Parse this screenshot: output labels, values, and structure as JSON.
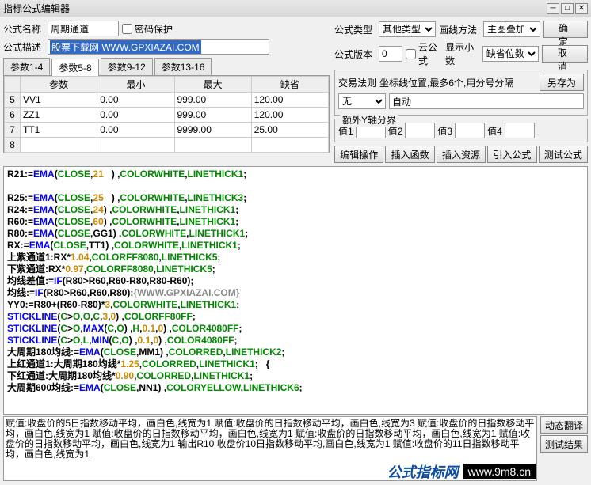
{
  "window": {
    "title": "指标公式编辑器"
  },
  "labels": {
    "formula_name": "公式名称",
    "password": "密码保护",
    "formula_desc": "公式描述",
    "formula_type": "公式类型",
    "draw_method": "画线方法",
    "formula_version": "公式版本",
    "cloud_formula": "云公式",
    "show_decimal": "显示小数",
    "trade_rule": "交易法则",
    "coord_hint": "坐标线位置,最多6个,用分号分隔",
    "extra_y": "额外Y轴分界",
    "val1": "值1",
    "val2": "值2",
    "val3": "值3",
    "val4": "值4",
    "param": "参数",
    "min": "最小",
    "max": "最大",
    "default": "缺省"
  },
  "fields": {
    "formula_name": "周期通道",
    "formula_desc": "股票下载网 WWW.GPXIAZAI.COM",
    "formula_type": "其他类型",
    "draw_method": "主图叠加",
    "formula_version": "0",
    "show_decimal": "缺省位数",
    "trade_rule": "无",
    "coord": "自动"
  },
  "tabs": [
    "参数1-4",
    "参数5-8",
    "参数9-12",
    "参数13-16"
  ],
  "active_tab": 1,
  "param_rows": [
    {
      "n": "5",
      "name": "VV1",
      "min": "0.00",
      "max": "999.00",
      "def": "120.00"
    },
    {
      "n": "6",
      "name": "ZZ1",
      "min": "0.00",
      "max": "999.00",
      "def": "120.00"
    },
    {
      "n": "7",
      "name": "TT1",
      "min": "0.00",
      "max": "9999.00",
      "def": "25.00"
    },
    {
      "n": "8",
      "name": "",
      "min": "",
      "max": "",
      "def": ""
    }
  ],
  "buttons": {
    "ok": "确 定",
    "cancel": "取 消",
    "save_as": "另存为",
    "edit_op": "编辑操作",
    "insert_fn": "插入函数",
    "insert_res": "插入资源",
    "import_formula": "引入公式",
    "test_formula": "测试公式",
    "dyn_trans": "动态翻译",
    "test_result": "测试结果"
  },
  "code_lines": [
    [
      [
        "R21:=",
        "black"
      ],
      [
        "EMA",
        "blue"
      ],
      [
        "(",
        "black"
      ],
      [
        "CLOSE",
        "green"
      ],
      [
        ",",
        "black"
      ],
      [
        "21",
        "orange"
      ],
      [
        "   ) ,",
        "black"
      ],
      [
        "COLORWHITE",
        "green"
      ],
      [
        ",",
        "black"
      ],
      [
        "LINETHICK1",
        "green"
      ],
      [
        ";",
        "black"
      ]
    ],
    [],
    [
      [
        "R25:=",
        "black"
      ],
      [
        "EMA",
        "blue"
      ],
      [
        "(",
        "black"
      ],
      [
        "CLOSE",
        "green"
      ],
      [
        ",",
        "black"
      ],
      [
        "25",
        "orange"
      ],
      [
        "   ) ,",
        "black"
      ],
      [
        "COLORWHITE",
        "green"
      ],
      [
        ",",
        "black"
      ],
      [
        "LINETHICK3",
        "green"
      ],
      [
        ";",
        "black"
      ]
    ],
    [
      [
        "R24:=",
        "black"
      ],
      [
        "EMA",
        "blue"
      ],
      [
        "(",
        "black"
      ],
      [
        "CLOSE",
        "green"
      ],
      [
        ",",
        "black"
      ],
      [
        "24",
        "orange"
      ],
      [
        ") ,",
        "black"
      ],
      [
        "COLORWHITE",
        "green"
      ],
      [
        ",",
        "black"
      ],
      [
        "LINETHICK1",
        "green"
      ],
      [
        ";",
        "black"
      ]
    ],
    [
      [
        "R60:=",
        "black"
      ],
      [
        "EMA",
        "blue"
      ],
      [
        "(",
        "black"
      ],
      [
        "CLOSE",
        "green"
      ],
      [
        ",",
        "black"
      ],
      [
        "60",
        "orange"
      ],
      [
        ") ,",
        "black"
      ],
      [
        "COLORWHITE",
        "green"
      ],
      [
        ",",
        "black"
      ],
      [
        "LINETHICK1",
        "green"
      ],
      [
        ";",
        "black"
      ]
    ],
    [
      [
        "R80:=",
        "black"
      ],
      [
        "EMA",
        "blue"
      ],
      [
        "(",
        "black"
      ],
      [
        "CLOSE",
        "green"
      ],
      [
        ",GG1) ,",
        "black"
      ],
      [
        "COLORWHITE",
        "green"
      ],
      [
        ",",
        "black"
      ],
      [
        "LINETHICK1",
        "green"
      ],
      [
        ";",
        "black"
      ]
    ],
    [
      [
        "RX:=",
        "black"
      ],
      [
        "EMA",
        "blue"
      ],
      [
        "(",
        "black"
      ],
      [
        "CLOSE",
        "green"
      ],
      [
        ",TT1) ,",
        "black"
      ],
      [
        "COLORWHITE",
        "green"
      ],
      [
        ",",
        "black"
      ],
      [
        "LINETHICK1",
        "green"
      ],
      [
        ";",
        "black"
      ]
    ],
    [
      [
        "上紫通道1:RX*",
        "black"
      ],
      [
        "1.04",
        "orange"
      ],
      [
        ",",
        "black"
      ],
      [
        "COLORFF8080",
        "green"
      ],
      [
        ",",
        "black"
      ],
      [
        "LINETHICK5",
        "green"
      ],
      [
        ";",
        "black"
      ]
    ],
    [
      [
        "下紫通道:RX*",
        "black"
      ],
      [
        "0.97",
        "orange"
      ],
      [
        ",",
        "black"
      ],
      [
        "COLORFF8080",
        "green"
      ],
      [
        ",",
        "black"
      ],
      [
        "LINETHICK5",
        "green"
      ],
      [
        ";",
        "black"
      ]
    ],
    [
      [
        "均线差值:=",
        "black"
      ],
      [
        "IF",
        "blue"
      ],
      [
        "(R80>R60,R60-R80,R80-R60);",
        "black"
      ]
    ],
    [
      [
        "均线:=",
        "black"
      ],
      [
        "IF",
        "blue"
      ],
      [
        "(R80>R60,R60,R80);",
        "black"
      ],
      [
        "{WWW.GPXIAZAI.COM}",
        "gray"
      ]
    ],
    [
      [
        "YY0:=R80+(R60-R80)*",
        "black"
      ],
      [
        "3",
        "orange"
      ],
      [
        ",",
        "black"
      ],
      [
        "COLORWHITE",
        "green"
      ],
      [
        ",",
        "black"
      ],
      [
        "LINETHICK1",
        "green"
      ],
      [
        ";",
        "black"
      ]
    ],
    [
      [
        "STICKLINE",
        "blue"
      ],
      [
        "(",
        "black"
      ],
      [
        "C",
        "green"
      ],
      [
        ">",
        "black"
      ],
      [
        "O",
        "green"
      ],
      [
        ",",
        "black"
      ],
      [
        "O",
        "green"
      ],
      [
        ",",
        "black"
      ],
      [
        "C",
        "green"
      ],
      [
        ",",
        "black"
      ],
      [
        "3",
        "orange"
      ],
      [
        ",",
        "black"
      ],
      [
        "0",
        "orange"
      ],
      [
        ") ,",
        "black"
      ],
      [
        "COLORFF80FF",
        "green"
      ],
      [
        ";",
        "black"
      ]
    ],
    [
      [
        "STICKLINE",
        "blue"
      ],
      [
        "(",
        "black"
      ],
      [
        "C",
        "green"
      ],
      [
        ">",
        "black"
      ],
      [
        "O",
        "green"
      ],
      [
        ",",
        "black"
      ],
      [
        "MAX",
        "blue"
      ],
      [
        "(",
        "black"
      ],
      [
        "C",
        "green"
      ],
      [
        ",",
        "black"
      ],
      [
        "O",
        "green"
      ],
      [
        ") ,",
        "black"
      ],
      [
        "H",
        "green"
      ],
      [
        ",",
        "black"
      ],
      [
        "0.1",
        "orange"
      ],
      [
        ",",
        "black"
      ],
      [
        "0",
        "orange"
      ],
      [
        ") ,",
        "black"
      ],
      [
        "COLOR4080FF",
        "green"
      ],
      [
        ";",
        "black"
      ]
    ],
    [
      [
        "STICKLINE",
        "blue"
      ],
      [
        "(",
        "black"
      ],
      [
        "C",
        "green"
      ],
      [
        ">",
        "black"
      ],
      [
        "O",
        "green"
      ],
      [
        ",",
        "black"
      ],
      [
        "L",
        "green"
      ],
      [
        ",",
        "black"
      ],
      [
        "MIN",
        "blue"
      ],
      [
        "(",
        "black"
      ],
      [
        "C",
        "green"
      ],
      [
        ",",
        "black"
      ],
      [
        "O",
        "green"
      ],
      [
        ") ,",
        "black"
      ],
      [
        "0.1",
        "orange"
      ],
      [
        ",",
        "black"
      ],
      [
        "0",
        "orange"
      ],
      [
        ") ,",
        "black"
      ],
      [
        "COLOR4080FF",
        "green"
      ],
      [
        ";",
        "black"
      ]
    ],
    [
      [
        "大周期180均线:=",
        "black"
      ],
      [
        "EMA",
        "blue"
      ],
      [
        "(",
        "black"
      ],
      [
        "CLOSE",
        "green"
      ],
      [
        ",MM1) ,",
        "black"
      ],
      [
        "COLORRED",
        "green"
      ],
      [
        ",",
        "black"
      ],
      [
        "LINETHICK2",
        "green"
      ],
      [
        ";",
        "black"
      ]
    ],
    [
      [
        "上红通道1:大周期180均线*",
        "black"
      ],
      [
        "1.25",
        "orange"
      ],
      [
        ",",
        "black"
      ],
      [
        "COLORRED",
        "green"
      ],
      [
        ",",
        "black"
      ],
      [
        "LINETHICK1",
        "green"
      ],
      [
        ";   {",
        "black"
      ]
    ],
    [
      [
        "下红通道:大周期180均线*",
        "black"
      ],
      [
        "0.90",
        "orange"
      ],
      [
        ",",
        "black"
      ],
      [
        "COLORRED",
        "green"
      ],
      [
        ",",
        "black"
      ],
      [
        "LINETHICK1",
        "green"
      ],
      [
        ";",
        "black"
      ]
    ],
    [
      [
        "大周期600均线:=",
        "black"
      ],
      [
        "EMA",
        "blue"
      ],
      [
        "(",
        "black"
      ],
      [
        "CLOSE",
        "green"
      ],
      [
        ",NN1) ,",
        "black"
      ],
      [
        "COLORYELLOW",
        "green"
      ],
      [
        ",",
        "black"
      ],
      [
        "LINETHICK6",
        "green"
      ],
      [
        ";",
        "black"
      ]
    ]
  ],
  "desc_lines": [
    "赋值:收盘价的5日指数移动平均，画白色,线宽为1",
    "赋值:收盘价的日指数移动平均，画白色,线宽为3",
    "赋值:收盘价的日指数移动平均，画白色,线宽为1",
    "赋值:收盘价的日指数移动平均，画白色,线宽为1",
    "赋值:收盘价的日指数移动平均，画白色,线宽为1",
    "赋值:收盘价的日指数移动平均，画白色,线宽为1",
    "输出R10  收盘价10日指数移动平均,画白色,线宽为1",
    "赋值:收盘价的11日指数移动平均，画白色,线宽为1"
  ],
  "watermark": {
    "brand": "公式指标网",
    "url": "www.9m8.cn"
  }
}
